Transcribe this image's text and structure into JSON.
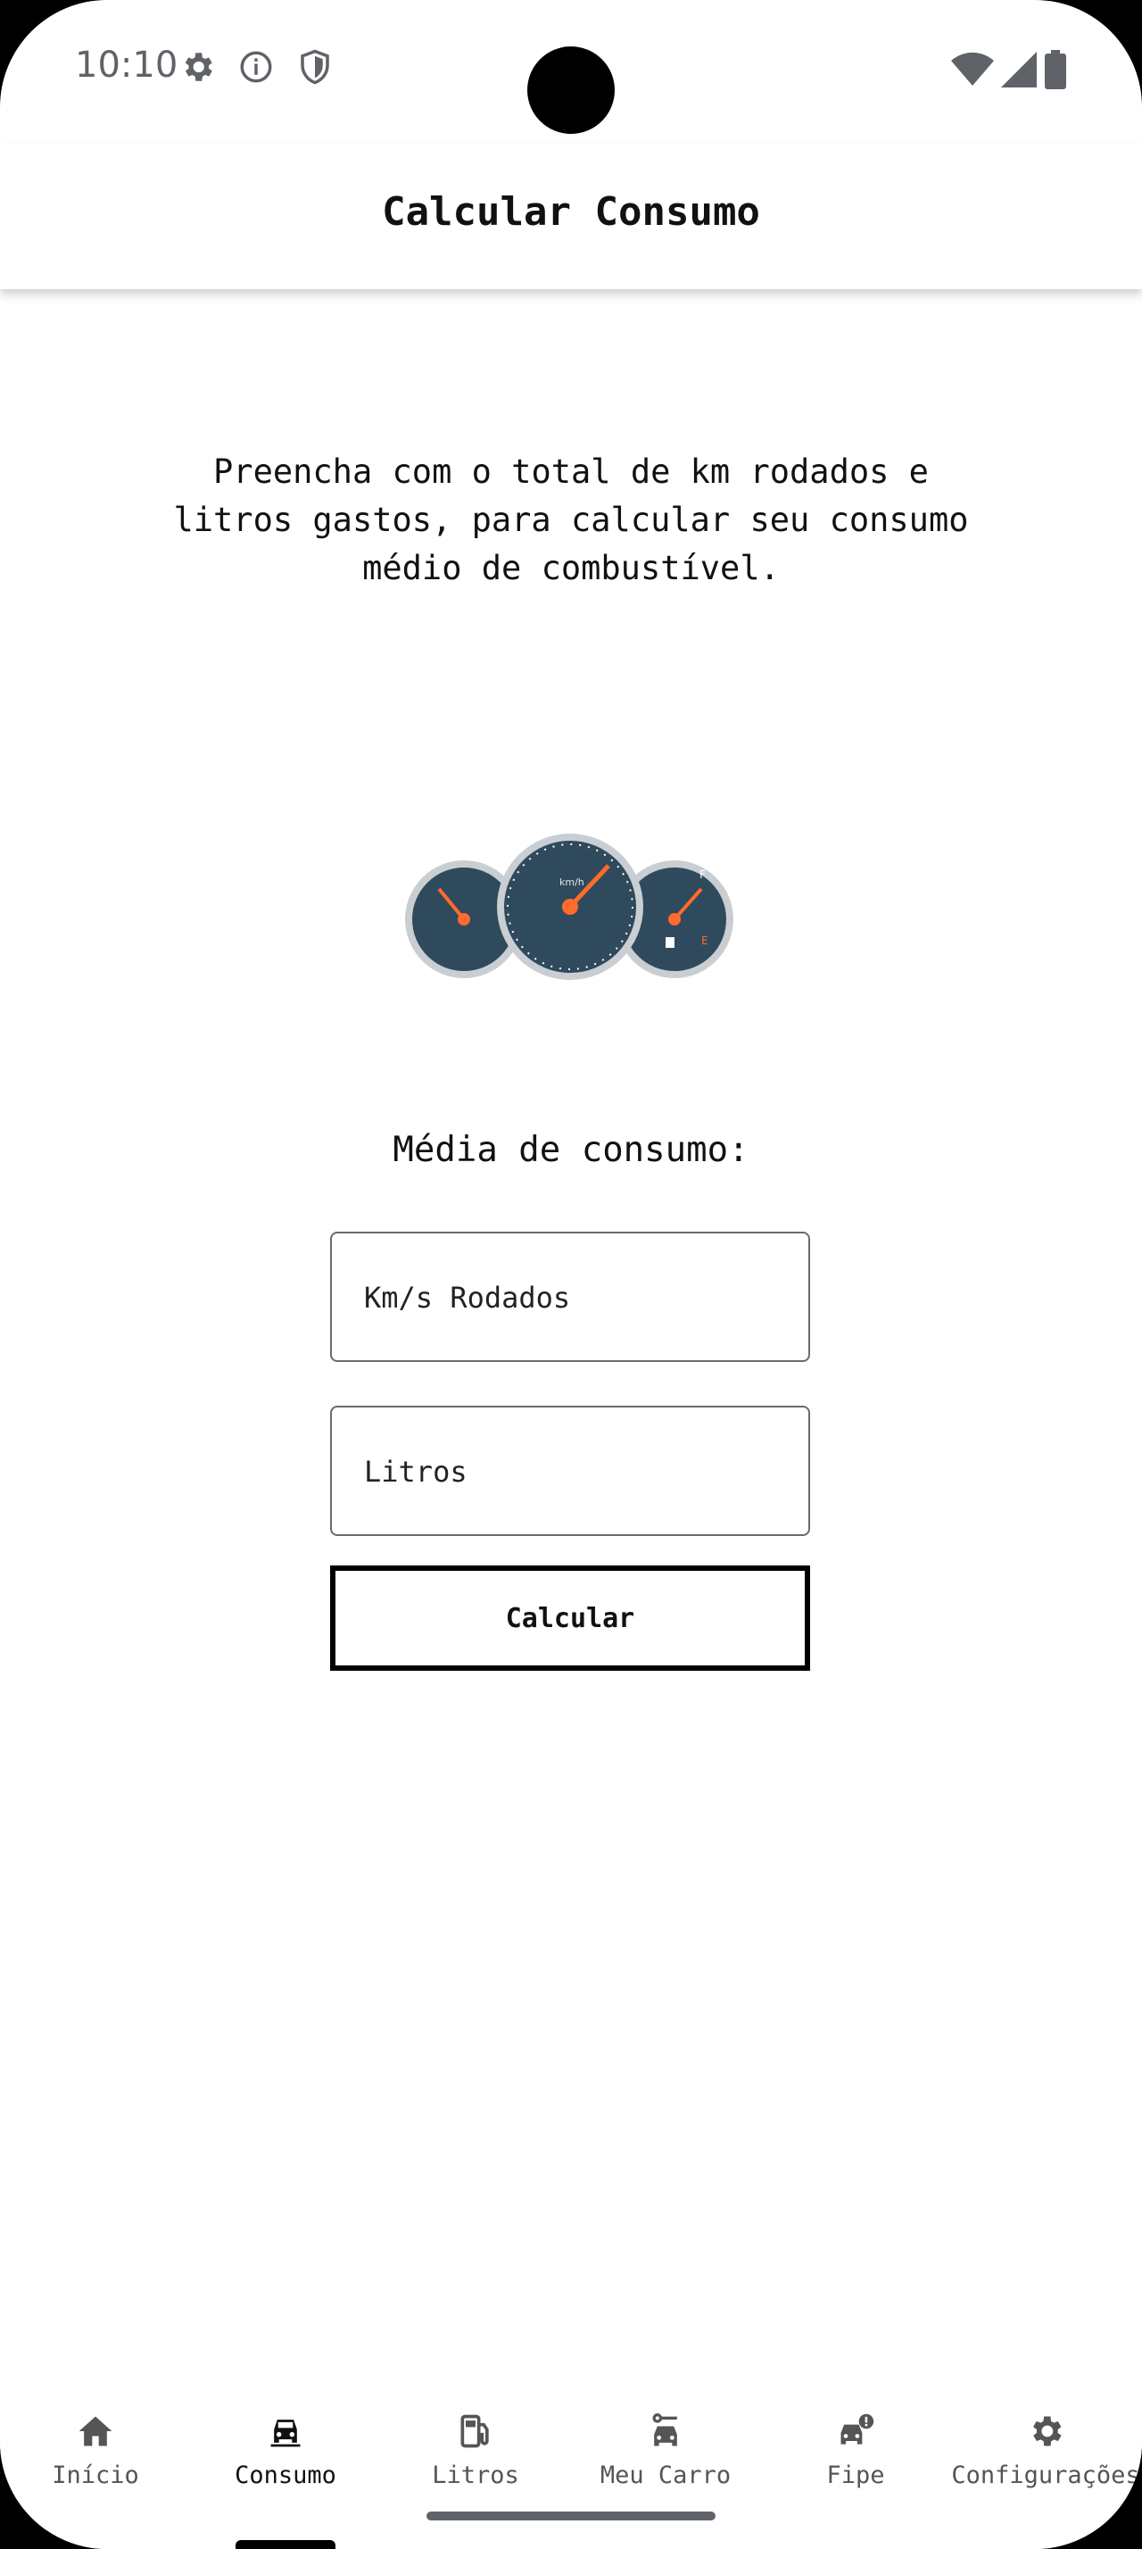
{
  "status_bar": {
    "time": "10:10"
  },
  "app_bar": {
    "title": "Calcular Consumo"
  },
  "main": {
    "intro": "Preencha com o total de km rodados e litros gastos, para calcular seu consumo médio de combustível.",
    "image": {
      "icon": "dashboard-gauges-icon",
      "gauge_labels": [
        "km/h",
        "F",
        "E"
      ]
    },
    "media_label": "Média de consumo:",
    "km_field": {
      "placeholder": "Km/s Rodados",
      "value": ""
    },
    "litros_field": {
      "placeholder": "Litros",
      "value": ""
    },
    "calc_button": "Calcular"
  },
  "bottom_nav": {
    "items": [
      {
        "label": "Início",
        "icon": "home-icon",
        "active": false
      },
      {
        "label": "Consumo",
        "icon": "car-icon",
        "active": true
      },
      {
        "label": "Litros",
        "icon": "fuel-pump-icon",
        "active": false
      },
      {
        "label": "Meu Carro",
        "icon": "car-settings-icon",
        "active": false
      },
      {
        "label": "Fipe",
        "icon": "car-alert-icon",
        "active": false
      },
      {
        "label": "Configurações",
        "icon": "gear-icon",
        "active": false
      }
    ]
  },
  "colors": {
    "gauge_face": "#2f4a5c",
    "needle": "#ff6b2b",
    "active": "#111111",
    "inactive": "#555555"
  }
}
